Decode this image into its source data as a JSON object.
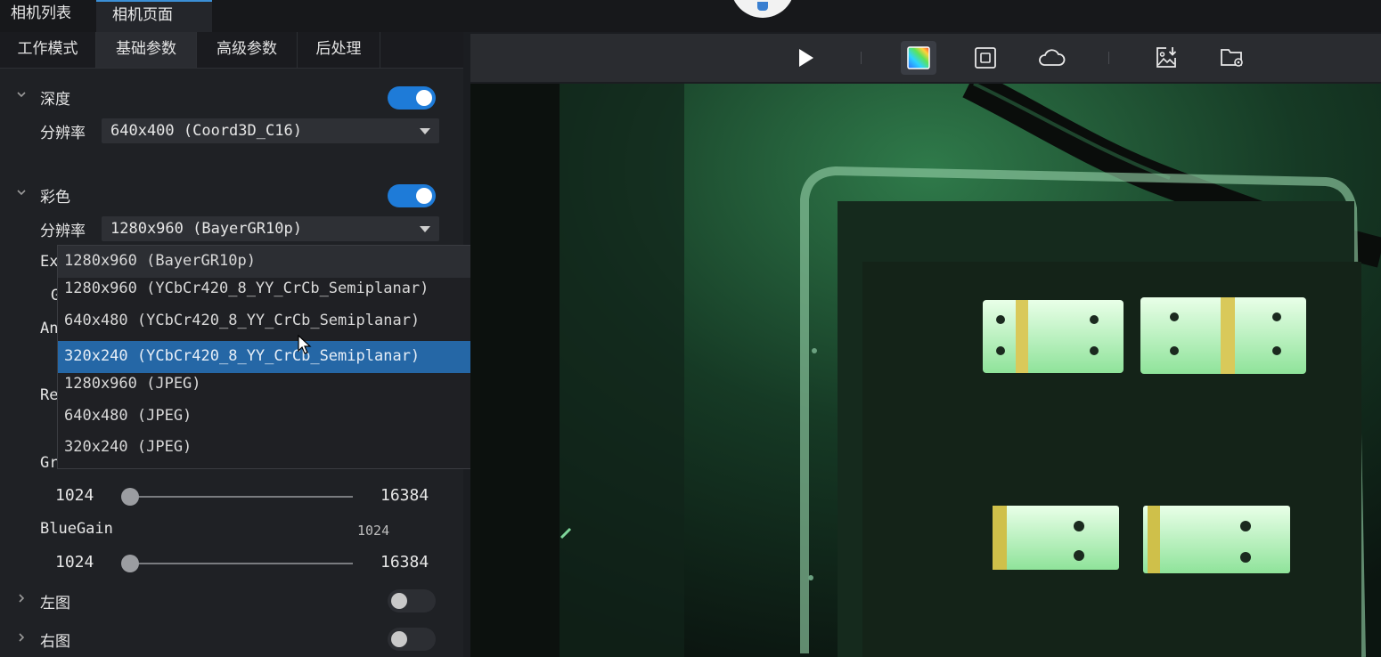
{
  "top_tabs": [
    "相机列表",
    "相机页面"
  ],
  "sub_tabs": [
    "工作模式",
    "基础参数",
    "高级参数",
    "后处理"
  ],
  "depth": {
    "label": "深度",
    "enabled": true,
    "resolution_label": "分辨率",
    "resolution_value": "640x400 (Coord3D_C16)"
  },
  "color": {
    "label": "彩色",
    "enabled": true,
    "resolution_label": "分辨率",
    "resolution_value": "1280x960 (BayerGR10p)",
    "options": [
      "1280x960 (BayerGR10p)",
      "1280x960 (YCbCr420_8_YY_CrCb_Semiplanar)",
      "640x480 (YCbCr420_8_YY_CrCb_Semiplanar)",
      "320x240 (YCbCr420_8_YY_CrCb_Semiplanar)",
      "1280x960 (JPEG)",
      "640x480 (JPEG)",
      "320x240 (JPEG)"
    ],
    "hovered_option_index": 3
  },
  "obscured_labels": [
    "Ex",
    "G",
    "An",
    "Re",
    "Gr"
  ],
  "green_gain": {
    "min": "1024",
    "max": "16384",
    "value": 1024
  },
  "blue_gain": {
    "label": "BlueGain",
    "value_text": "1024",
    "min": "1024",
    "max": "16384",
    "value": 1024
  },
  "left_image": {
    "label": "左图",
    "enabled": false
  },
  "right_image": {
    "label": "右图",
    "enabled": false
  },
  "toolbar_icons": [
    "play-icon",
    "color-image-icon",
    "depth-frame-icon",
    "point-cloud-icon",
    "save-image-icon",
    "folder-settings-icon"
  ],
  "colors": {
    "accent": "#1e7bd8",
    "highlight": "#2567a6",
    "panel": "#1f2125"
  }
}
